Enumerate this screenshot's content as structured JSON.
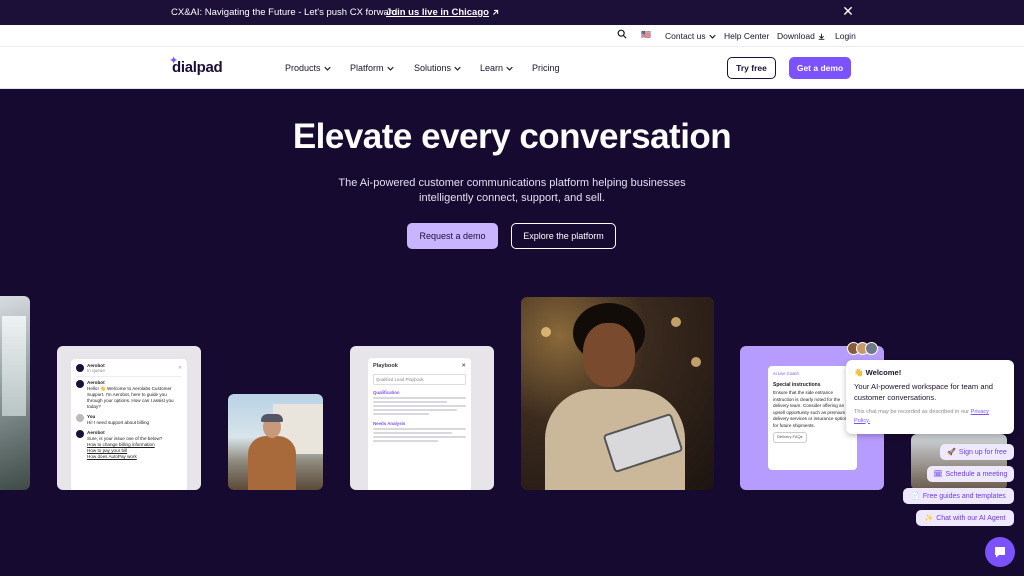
{
  "announcement": {
    "message": "CX&AI: Navigating the Future - Let's push CX forward",
    "cta": "Join us live in Chicago",
    "close_glyph": "✕"
  },
  "utility_nav": {
    "search_glyph": "⌕",
    "flag_glyph": "🇺🇸",
    "contact": "Contact us",
    "help": "Help Center",
    "download": "Download",
    "login": "Login"
  },
  "nav": {
    "logo": "dialpad",
    "logo_spark": "✦",
    "menu": [
      "Products",
      "Platform",
      "Solutions",
      "Learn",
      "Pricing"
    ],
    "try_free": "Try free",
    "get_demo": "Get a demo"
  },
  "hero": {
    "title": "Elevate every conversation",
    "subtitle": "The Ai-powered customer communications platform helping businesses intelligently connect, support, and sell.",
    "primary_cta": "Request a demo",
    "secondary_cta": "Explore the platform"
  },
  "chat_card": {
    "bot_name": "Aerobot",
    "bot_status": "In queue",
    "bot_message": "Hello! 👋 Welcome to Aerolabs Customer Support. I'm Aerobot, here to guide you through your options. How can I assist you today?",
    "user_label": "You",
    "user_message": "Hi! I need support about billing",
    "bot_reply": "Sure, is your issue one of the below?",
    "links": [
      "How to change billing information",
      "How to pay your bill",
      "How does AutoPay work"
    ]
  },
  "playbook_card": {
    "title": "Playbook",
    "select": "Qualified Lead Playbook",
    "sections": [
      "Qualification",
      "Needs Analysis"
    ]
  },
  "coach_card": {
    "tag": "Ai Live Coach",
    "heading": "Special instructions",
    "body": "Ensure that the side entrance instruction is clearly noted for the delivery team. Consider offering an upsell opportunity such as premium delivery services or insurance options for future shipments.",
    "chip": "Delivery FAQs"
  },
  "chat_widget": {
    "welcome_title": "👋 Welcome!",
    "welcome_message": "Your AI-powered workspace for team and customer conversations.",
    "privacy_text": "This chat may be recorded as described in our",
    "privacy_link": "Privacy Policy.",
    "options": [
      {
        "icon": "🚀",
        "label": "Sign up for free"
      },
      {
        "icon": "🗓",
        "label": "Schedule a meeting"
      },
      {
        "icon": "📄",
        "label": "Free guides and templates"
      },
      {
        "icon": "✨",
        "label": "Chat with our AI Agent"
      }
    ]
  },
  "colors": {
    "hero_bg": "#170a30",
    "brand_purple": "#7c52ff",
    "lavender": "#c9b5ff"
  }
}
